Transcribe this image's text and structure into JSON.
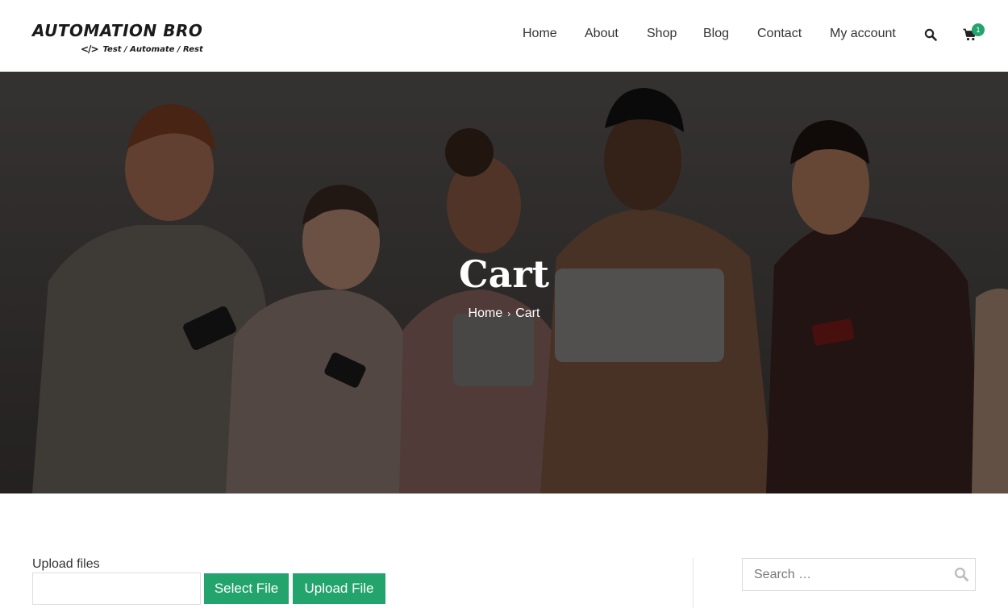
{
  "brand": {
    "name": "AUTOMATION BRO",
    "tagline": "Test / Automate / Rest",
    "code_glyph": "</>"
  },
  "nav": {
    "items": [
      {
        "label": "Home"
      },
      {
        "label": "About"
      },
      {
        "label": "Shop"
      },
      {
        "label": "Blog"
      },
      {
        "label": "Contact"
      },
      {
        "label": "My account"
      }
    ],
    "search_icon": "search-icon",
    "cart_icon": "cart-icon",
    "cart_count": "1"
  },
  "hero": {
    "title": "Cart",
    "breadcrumb": {
      "home": "Home",
      "separator": "›",
      "current": "Cart"
    }
  },
  "upload": {
    "label": "Upload files",
    "select_button": "Select File",
    "upload_button": "Upload File"
  },
  "sidebar": {
    "search_placeholder": "Search …"
  },
  "colors": {
    "accent": "#24a46d",
    "text": "#333333",
    "hero_overlay": "rgba(0,0,0,0.45)"
  }
}
